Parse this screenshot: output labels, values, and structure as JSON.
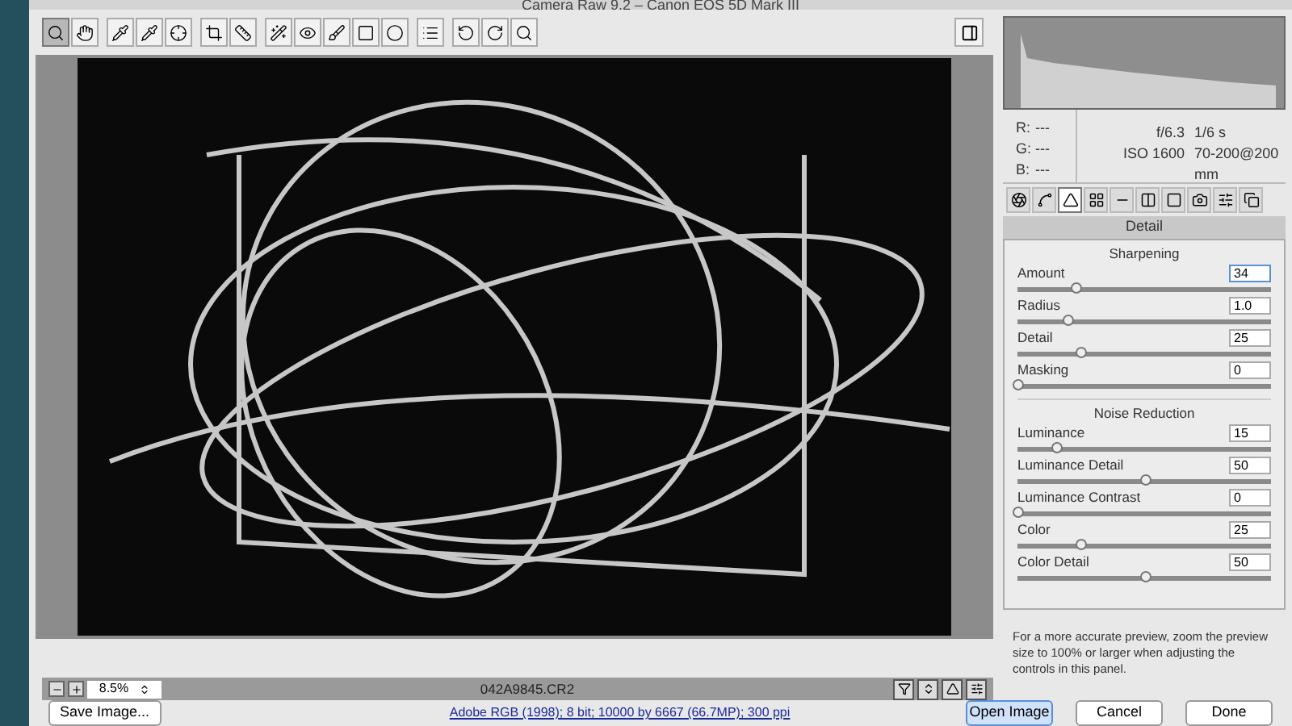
{
  "window": {
    "title": "Camera Raw 9.2  –  Canon EOS 5D Mark III"
  },
  "toolbar": {
    "tools": [
      {
        "selected": true
      },
      {
        "selected": false
      },
      {
        "selected": false
      },
      {
        "selected": false
      },
      {
        "selected": false
      },
      {
        "selected": false
      },
      {
        "selected": false
      },
      {
        "selected": false
      },
      {
        "selected": false
      },
      {
        "selected": false
      },
      {
        "selected": false
      },
      {
        "selected": false
      },
      {
        "selected": false
      },
      {
        "selected": false
      },
      {
        "selected": false
      },
      {
        "selected": false
      }
    ]
  },
  "info": {
    "r": "R:",
    "g": "G:",
    "b": "B:",
    "r_value": "---",
    "g_value": "---",
    "b_value": "---",
    "aperture": "f/6.3",
    "shutter": "1/6 s",
    "iso": "ISO 1600",
    "lens": "70-200@200 mm"
  },
  "panel_tabs": [
    {
      "selected": false
    },
    {
      "selected": false
    },
    {
      "selected": true
    },
    {
      "selected": false
    },
    {
      "selected": false
    },
    {
      "selected": false
    },
    {
      "selected": false
    },
    {
      "selected": false
    },
    {
      "selected": false
    },
    {
      "selected": false
    }
  ],
  "panel": {
    "title": "Detail",
    "sections": [
      {
        "heading": "Sharpening",
        "sliders": [
          {
            "name": "Amount",
            "value": "34",
            "level": 0.23,
            "focused": true
          },
          {
            "name": "Radius",
            "value": "1.0",
            "level": 0.2,
            "focused": false
          },
          {
            "name": "Detail",
            "value": "25",
            "level": 0.25,
            "focused": false
          },
          {
            "name": "Masking",
            "value": "0",
            "level": 0,
            "focused": false
          }
        ]
      },
      {
        "heading": "Noise Reduction",
        "sliders": [
          {
            "name": "Luminance",
            "value": "15",
            "level": 0.15,
            "focused": false
          },
          {
            "name": "Luminance Detail",
            "value": "50",
            "level": 0.5,
            "focused": false
          },
          {
            "name": "Luminance Contrast",
            "value": "0",
            "level": 0,
            "focused": false
          },
          {
            "name": "Color",
            "value": "25",
            "level": 0.25,
            "focused": false
          },
          {
            "name": "Color Detail",
            "value": "50",
            "level": 0.5,
            "focused": false
          }
        ]
      }
    ],
    "note": "For a more accurate preview, zoom the preview size to 100% or larger when adjusting the controls in this panel."
  },
  "preview": {
    "zoom": "8.5%",
    "filename": "042A9845.CR2"
  },
  "footer": {
    "save": "Save Image...",
    "workflow": "Adobe RGB (1998); 8 bit; 10000 by 6667 (66.7MP); 300 ppi",
    "buttons": [
      {
        "label": "Open Image",
        "selected": true
      },
      {
        "label": "Cancel",
        "selected": false
      },
      {
        "label": "Done",
        "selected": false
      }
    ]
  }
}
